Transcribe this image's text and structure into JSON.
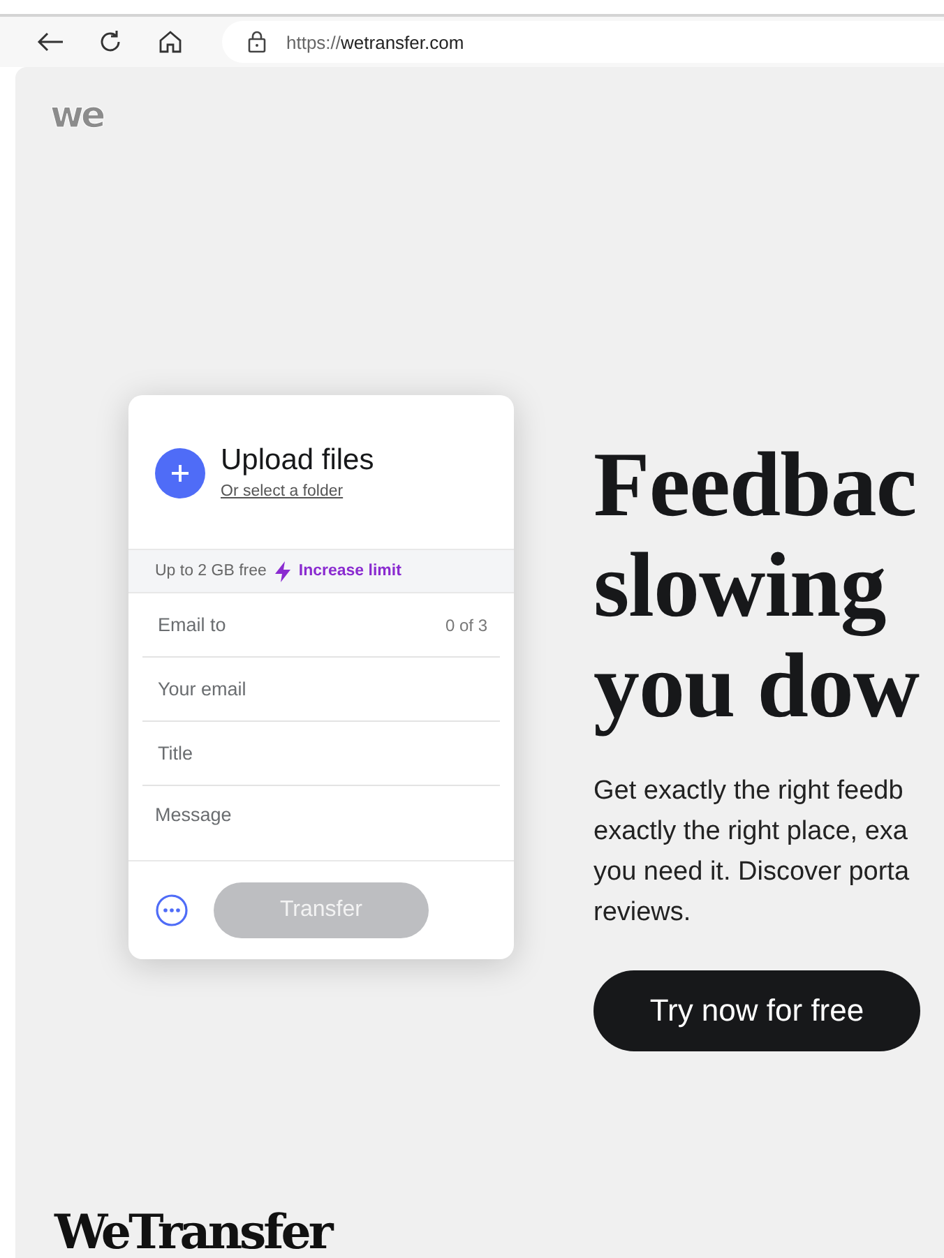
{
  "browser": {
    "url_scheme": "https://",
    "url_host": "wetransfer.com"
  },
  "logo": "we",
  "upload_card": {
    "title": "Upload files",
    "folder_link": "Or select a folder",
    "limit_note": "Up to 2 GB free",
    "increase_link": "Increase limit",
    "fields": [
      {
        "placeholder": "Email to",
        "counter": "0 of 3"
      },
      {
        "placeholder": "Your email"
      },
      {
        "placeholder": "Title"
      },
      {
        "placeholder": "Message"
      }
    ],
    "transfer_button": {
      "label": "Transfer",
      "disabled": true
    }
  },
  "hero": {
    "heading_lines": [
      "Feedbac",
      "slowing",
      "you dow"
    ],
    "paragraph_lines": [
      "Get exactly the right feedb",
      "exactly the right place, exa",
      "you need it. Discover porta",
      "reviews."
    ],
    "cta": "Try now for free"
  },
  "footer_logo": "WeTransfer"
}
